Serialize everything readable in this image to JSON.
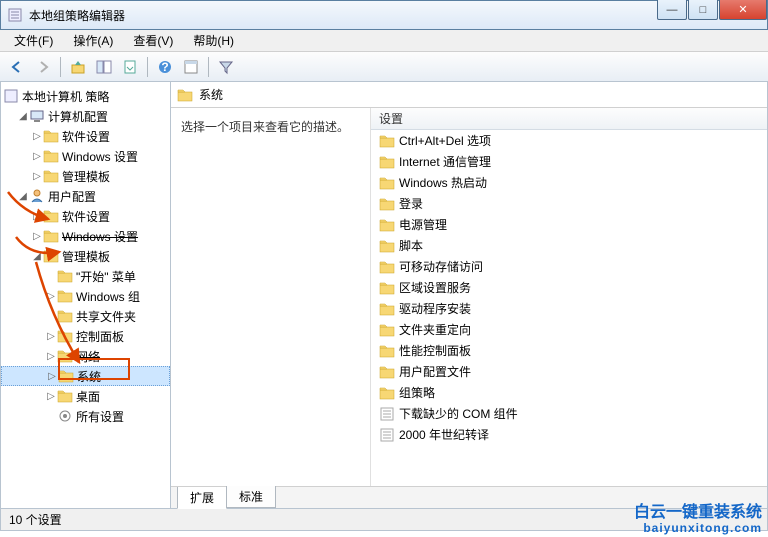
{
  "window": {
    "title": "本地组策略编辑器"
  },
  "menu": {
    "file": "文件(F)",
    "action": "操作(A)",
    "view": "查看(V)",
    "help": "帮助(H)"
  },
  "tree": {
    "root": "本地计算机 策略",
    "computer_cfg": "计算机配置",
    "cc_soft": "软件设置",
    "cc_win": "Windows 设置",
    "cc_admin": "管理模板",
    "user_cfg": "用户配置",
    "uc_soft": "软件设置",
    "uc_win": "Windows 设置",
    "uc_admin": "管理模板",
    "start_menu": "\"开始\" 菜单",
    "win_comp": "Windows 组",
    "shared": "共享文件夹",
    "ctrl_panel": "控制面板",
    "network": "网络",
    "system": "系统",
    "desktop": "桌面",
    "all_settings": "所有设置"
  },
  "right": {
    "header": "系统",
    "desc": "选择一个项目来查看它的描述。",
    "colhdr": "设置",
    "items": [
      "Ctrl+Alt+Del 选项",
      "Internet 通信管理",
      "Windows 热启动",
      "登录",
      "电源管理",
      "脚本",
      "可移动存储访问",
      "区域设置服务",
      "驱动程序安装",
      "文件夹重定向",
      "性能控制面板",
      "用户配置文件",
      "组策略",
      "下载缺少的 COM 组件",
      "2000 年世纪转译"
    ],
    "tab_ext": "扩展",
    "tab_std": "标准"
  },
  "status": {
    "text": "10 个设置"
  },
  "watermark": {
    "l1": "白云一键重装系统",
    "l2": "baiyunxitong.com"
  }
}
